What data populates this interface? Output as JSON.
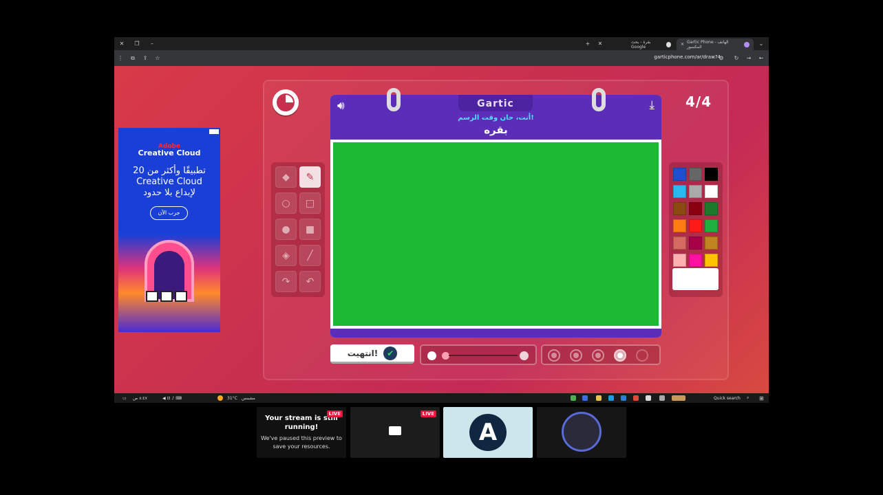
{
  "browser": {
    "tabs": [
      {
        "title": "Gartic Phone - الهاتف المكسور",
        "active": true
      },
      {
        "title": "بقرة - بحث Google",
        "active": false
      }
    ],
    "url": "garticphone.com/ar/draw?4"
  },
  "game": {
    "round_counter": "4/4",
    "logo": "Gartic",
    "prompt_label": "أنت، حان وقت الرسم!",
    "word": "بقره",
    "canvas_color": "#1db934",
    "done_label": "انتهيت!",
    "tools": [
      "eraser-icon",
      "pencil-icon",
      "circle-outline-icon",
      "square-outline-icon",
      "circle-filled-icon",
      "square-filled-icon",
      "fill-bucket-icon",
      "line-icon",
      "redo-icon",
      "undo-icon"
    ],
    "active_tool": "pencil-icon",
    "palette": [
      "#1f4fd1",
      "#666666",
      "#000000",
      "#2ab8ef",
      "#aaaaaa",
      "#ffffff",
      "#8a4a12",
      "#8b0010",
      "#1e7a2a",
      "#ff7b14",
      "#ff1a1a",
      "#20b040",
      "#d46a60",
      "#a80048",
      "#c08420",
      "#ffb0b0",
      "#ff10a0",
      "#ffc400"
    ],
    "selected_color": "#ffffff",
    "brush_sizes": 5,
    "selected_opacity_index": 3
  },
  "ad": {
    "brand_line1": "Adobe",
    "brand_line2": "Creative Cloud",
    "copy": "20 تطبيقًا وأكثر من Creative Cloud لإبداع بلا حدود",
    "cta": "جرب الآن"
  },
  "taskbar": {
    "weather": "31°C",
    "weather_label": "مشمس",
    "time": "٨:٤٧ ص",
    "search": "Quick search"
  },
  "stream_previews": {
    "notice_title": "Your stream is still running!",
    "notice_body": "We've paused this preview to save your resources.",
    "live_label": "LIVE"
  }
}
